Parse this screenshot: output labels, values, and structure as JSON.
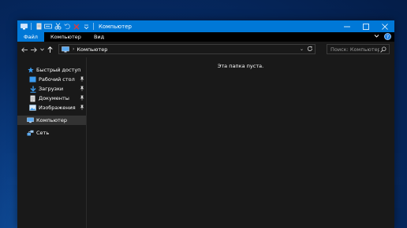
{
  "window": {
    "title": "Компьютер"
  },
  "quick_access_toolbar": {
    "icons": [
      "computer-icon",
      "properties-icon",
      "rename-icon",
      "cut-icon",
      "undo-icon",
      "delete-icon",
      "customize-dropdown-icon"
    ]
  },
  "ribbon": {
    "tabs": [
      {
        "label": "Файл",
        "active": true
      },
      {
        "label": "Компьютер",
        "active": false
      },
      {
        "label": "Вид",
        "active": false
      }
    ],
    "help_label": "?"
  },
  "address_bar": {
    "path": [
      "Компьютер"
    ],
    "search_placeholder": "Поиск: Компьютер"
  },
  "sidebar": {
    "quick_access": {
      "label": "Быстрый доступ",
      "items": [
        {
          "label": "Рабочий стол",
          "icon": "desktop-icon",
          "pinned": true
        },
        {
          "label": "Загрузки",
          "icon": "download-icon",
          "pinned": true
        },
        {
          "label": "Документы",
          "icon": "document-icon",
          "pinned": true
        },
        {
          "label": "Изображения",
          "icon": "pictures-icon",
          "pinned": true
        }
      ]
    },
    "computer": {
      "label": "Компьютер",
      "selected": true
    },
    "network": {
      "label": "Сеть"
    }
  },
  "main": {
    "empty_message": "Эта папка пуста."
  },
  "colors": {
    "accent": "#0078d7",
    "window_bg": "#191919",
    "menu_bg": "#000000",
    "selected_bg": "#333333"
  }
}
